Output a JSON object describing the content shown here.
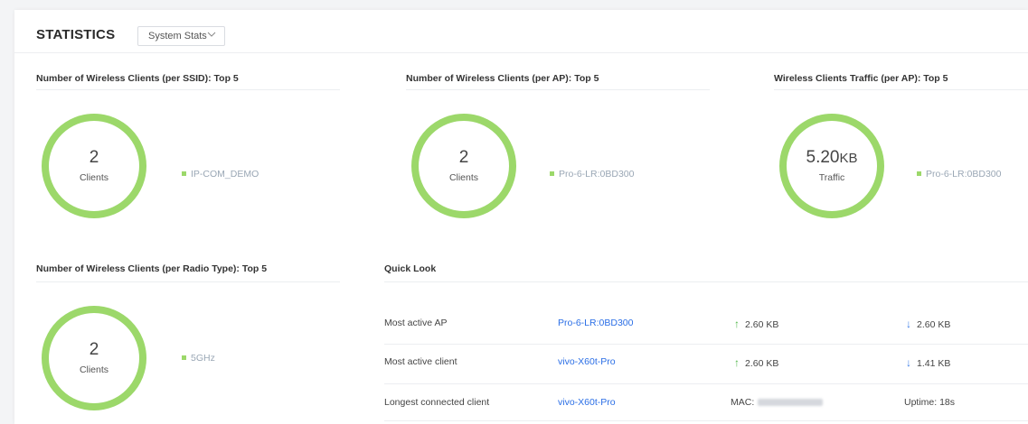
{
  "header": {
    "title": "STATISTICS",
    "select_value": "System Stats"
  },
  "colors": {
    "ring": "#9cd86a",
    "link": "#2a6ee6",
    "up_arrow": "#52b749",
    "down_arrow": "#3f7ee8"
  },
  "cards": [
    {
      "title": "Number of Wireless Clients (per SSID): Top 5",
      "value": "2",
      "unit": "",
      "caption": "Clients",
      "legend": "IP-COM_DEMO"
    },
    {
      "title": "Number of Wireless Clients (per AP): Top 5",
      "value": "2",
      "unit": "",
      "caption": "Clients",
      "legend": "Pro-6-LR:0BD300"
    },
    {
      "title": "Wireless Clients Traffic (per AP): Top 5",
      "value": "5.20",
      "unit": "KB",
      "caption": "Traffic",
      "legend": "Pro-6-LR:0BD300"
    },
    {
      "title": "Number of Wireless Clients (per Radio Type): Top 5",
      "value": "2",
      "unit": "",
      "caption": "Clients",
      "legend": "5GHz"
    }
  ],
  "quick_look": {
    "title": "Quick Look",
    "rows": [
      {
        "label": "Most active AP",
        "link": "Pro-6-LR:0BD300",
        "up": "2.60 KB",
        "down": "2.60 KB"
      },
      {
        "label": "Most active client",
        "link": "vivo-X60t-Pro",
        "up": "2.60 KB",
        "down": "1.41 KB"
      },
      {
        "label": "Longest connected client",
        "link": "vivo-X60t-Pro",
        "mac_label": "MAC:",
        "uptime": "Uptime:  18s"
      }
    ]
  },
  "icons": {
    "select_chevron": "chevron-down-icon",
    "upload": "arrow-up-icon",
    "download": "arrow-down-icon",
    "legend": "legend-dot-icon"
  }
}
